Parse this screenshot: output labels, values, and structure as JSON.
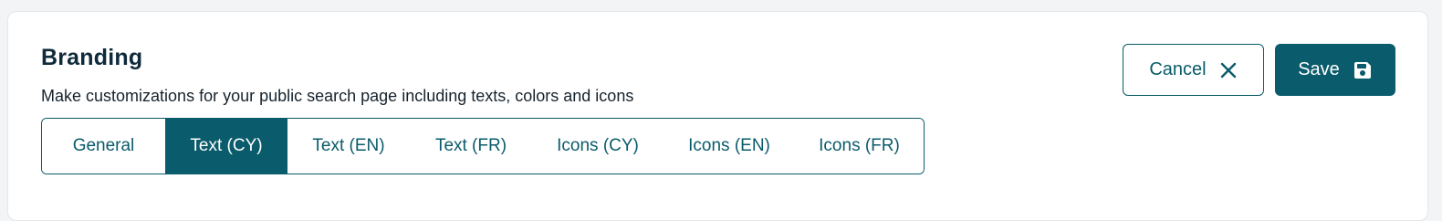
{
  "header": {
    "title": "Branding",
    "subtitle": "Make customizations for your public search page including texts, colors and icons"
  },
  "tabs": [
    {
      "label": "General",
      "active": false
    },
    {
      "label": "Text (CY)",
      "active": true
    },
    {
      "label": "Text (EN)",
      "active": false
    },
    {
      "label": "Text (FR)",
      "active": false
    },
    {
      "label": "Icons (CY)",
      "active": false
    },
    {
      "label": "Icons (EN)",
      "active": false
    },
    {
      "label": "Icons (FR)",
      "active": false
    }
  ],
  "actions": {
    "cancel_label": "Cancel",
    "cancel_icon": "close-icon",
    "save_label": "Save",
    "save_icon": "floppy-disk-icon"
  },
  "colors": {
    "primary": "#0a5b6b",
    "title": "#0f2a3a",
    "background": "#f3f4f6",
    "card": "#ffffff"
  }
}
